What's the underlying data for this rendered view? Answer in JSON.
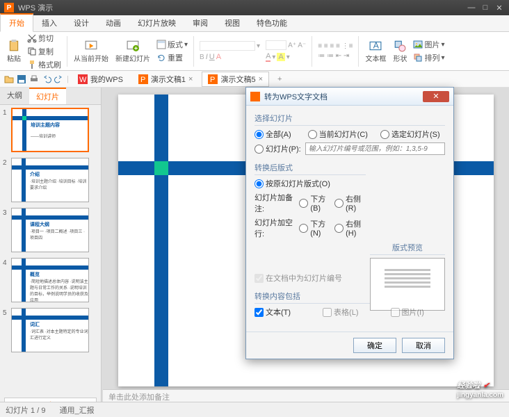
{
  "app": {
    "title": "WPS 演示"
  },
  "menu": {
    "tabs": [
      "开始",
      "插入",
      "设计",
      "动画",
      "幻灯片放映",
      "审阅",
      "视图",
      "特色功能"
    ],
    "active": 0
  },
  "ribbon": {
    "paste": "粘贴",
    "cut": "剪切",
    "copy": "复制",
    "fmtpaint": "格式刷",
    "fromcurrent": "从当前开始",
    "newslide": "新建幻灯片",
    "layout": "版式",
    "reset": "重置",
    "textbox": "文本框",
    "shape": "形状",
    "picture": "图片",
    "arrange": "排列"
  },
  "docs": {
    "items": [
      {
        "icon": "wps",
        "label": "我的WPS"
      },
      {
        "icon": "ppt",
        "label": "演示文稿1"
      },
      {
        "icon": "ppt",
        "label": "演示文稿5"
      }
    ],
    "active": 2
  },
  "leftpanel": {
    "tabs": [
      "大纲",
      "幻灯片"
    ],
    "active": 1,
    "slides": [
      {
        "n": "1",
        "title": "培训主题内容",
        "sub": "——培训讲师"
      },
      {
        "n": "2",
        "title": "介绍",
        "sub": "·培训主题介绍\n·培训目标\n·培训要求介绍"
      },
      {
        "n": "3",
        "title": "课程大纲",
        "sub": "·项目一\n·项目二概述\n·项目三\n·项目四"
      },
      {
        "n": "4",
        "title": "概览",
        "sub": "·简短地描述总体内容\n·说明该主题与日常工作的关系\n·说明培训的目标，举例说明学员的收获及应用"
      },
      {
        "n": "5",
        "title": "词汇",
        "sub": "·词汇表\n·对本主题特定的专业词汇进行定义"
      }
    ],
    "selected": 0
  },
  "notes": {
    "placeholder": "单击此处添加备注"
  },
  "status": {
    "slide": "幻灯片 1 / 9",
    "template": "通用_汇报"
  },
  "dialog": {
    "title": "转为WPS文字文档",
    "g1": {
      "label": "选择幻灯片",
      "all": "全部(A)",
      "current": "当前幻灯片(C)",
      "selected": "选定幻灯片(S)",
      "range": "幻灯片(P):",
      "placeholder": "输入幻灯片编号或范围，例如：1,3,5-9"
    },
    "g2": {
      "label": "转换后版式",
      "orig": "按原幻灯片版式(O)",
      "notes": "幻灯片加备注:",
      "below": "下方(B)",
      "right": "右侧(R)",
      "blank": "幻灯片加空行:",
      "belowN": "下方(N)",
      "rightH": "右侧(H)",
      "numbering": "在文档中为幻灯片编号"
    },
    "g3": {
      "label": "转换内容包括",
      "text": "文本(T)",
      "table": "表格(L)",
      "image": "图片(I)"
    },
    "preview": "版式预览",
    "ok": "确定",
    "cancel": "取消"
  },
  "watermark": {
    "brand": "经验啦",
    "url": "jingyanla.com"
  }
}
